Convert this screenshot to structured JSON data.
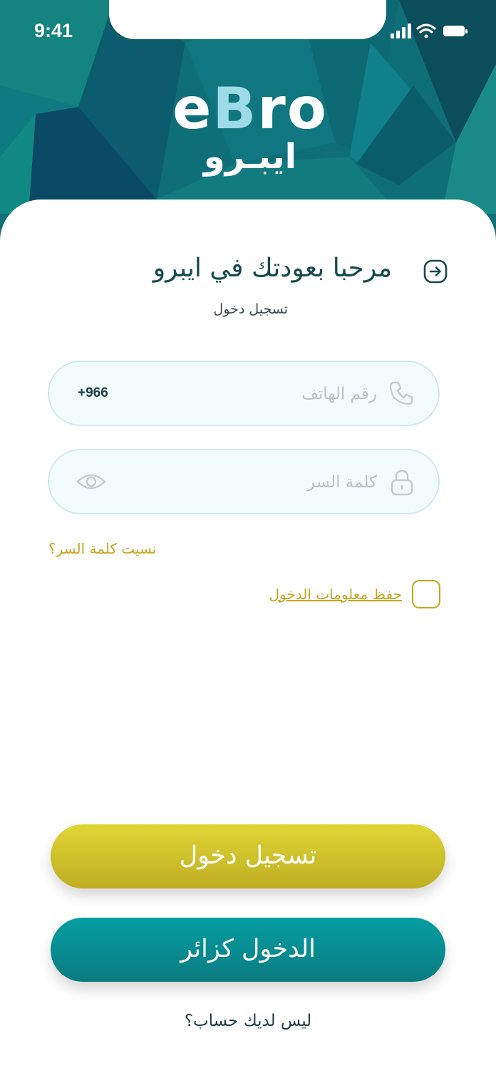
{
  "status_bar": {
    "time": "9:41"
  },
  "header": {
    "logo_latin_part1": "e",
    "logo_latin_part2": "B",
    "logo_latin_part3": "ro",
    "logo_arabic": "ايبـرو"
  },
  "login": {
    "title": "مرحبا بعودتك في ايبرو",
    "subtitle": "تسجيل دخول",
    "phone_placeholder": "رقم الهاتف",
    "country_code": "+966",
    "password_placeholder": "كلمة السر",
    "forgot_password": "نسيت كلمة السر؟",
    "remember_me": "حفظ معلومات الدخول",
    "login_button": "تسجيل دخول",
    "guest_button": "الدخول كزائر",
    "signup_link": "ليس لديك حساب؟"
  },
  "colors": {
    "primary_teal": "#0a7b80",
    "accent_gold": "#c9a51e",
    "title_text": "#164a4e"
  }
}
